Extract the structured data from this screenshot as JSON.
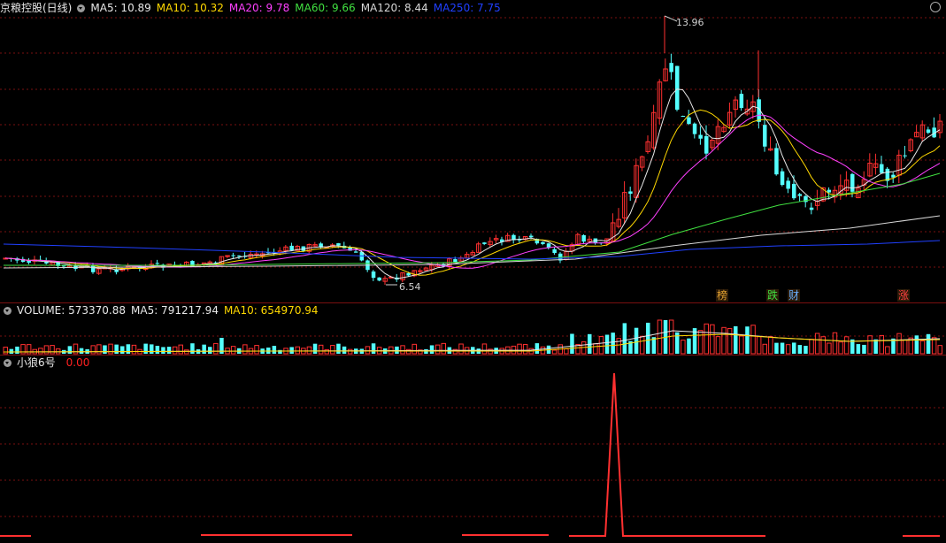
{
  "main_panel": {
    "title": "京粮控股(日线)",
    "ma_items": [
      {
        "label": "MA5: 10.89",
        "color": "#e8e8e8"
      },
      {
        "label": "MA10: 10.32",
        "color": "#ffd800"
      },
      {
        "label": "MA20: 9.78",
        "color": "#ff40ff"
      },
      {
        "label": "MA60: 9.66",
        "color": "#40e040"
      },
      {
        "label": "MA120: 8.44",
        "color": "#d8d8d8"
      },
      {
        "label": "MA250: 7.75",
        "color": "#2040ff"
      }
    ],
    "high_label": "13.96",
    "low_label": "6.54",
    "flags": [
      {
        "text": "榜",
        "color": "#e0a030"
      },
      {
        "text": "跌",
        "color": "#40e040"
      },
      {
        "text": "财",
        "color": "#6ab0ff"
      },
      {
        "text": "涨",
        "color": "#ff4040"
      }
    ]
  },
  "volume_panel": {
    "items": [
      {
        "label": "VOLUME: 573370.88",
        "color": "#e8e8e8"
      },
      {
        "label": "MA5: 791217.94",
        "color": "#e8e8e8"
      },
      {
        "label": "MA10: 654970.94",
        "color": "#ffd800"
      }
    ]
  },
  "indicator_panel": {
    "name": "小狼6号",
    "value": "0.00",
    "value_color": "#ff2020"
  },
  "colors": {
    "up": "#ff3030",
    "down": "#54ffff",
    "grid": "#7a1010"
  }
}
